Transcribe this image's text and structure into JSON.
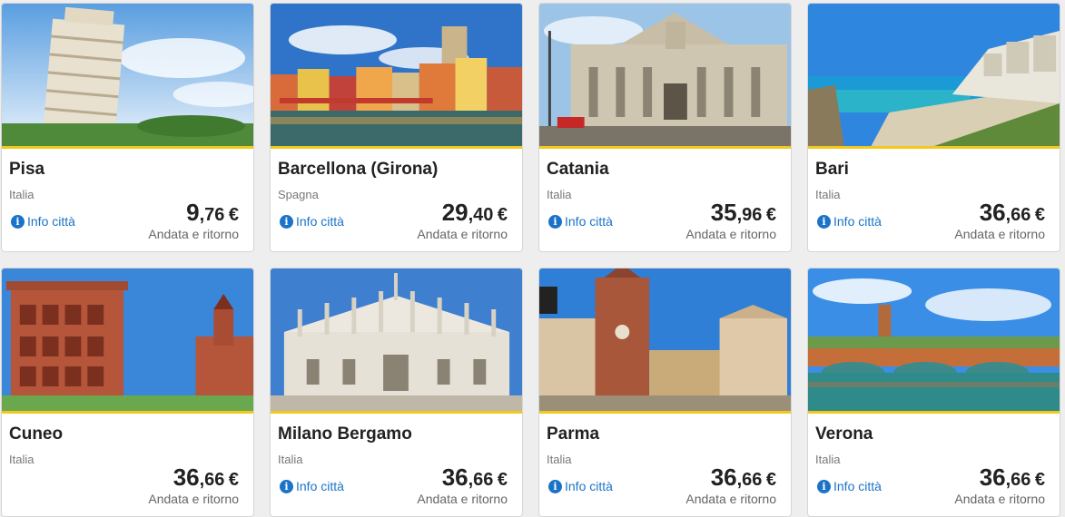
{
  "cards": [
    {
      "city": "Pisa",
      "country": "Italia",
      "info": "Info città",
      "price_int": "9",
      "price_dec": ",76",
      "currency": "€",
      "trip": "Andata e ritorno",
      "show_info": true,
      "scene": "pisa"
    },
    {
      "city": "Barcellona (Girona)",
      "country": "Spagna",
      "info": "Info città",
      "price_int": "29",
      "price_dec": ",40",
      "currency": "€",
      "trip": "Andata e ritorno",
      "show_info": true,
      "scene": "girona"
    },
    {
      "city": "Catania",
      "country": "Italia",
      "info": "Info città",
      "price_int": "35",
      "price_dec": ",96",
      "currency": "€",
      "trip": "Andata e ritorno",
      "show_info": true,
      "scene": "catania"
    },
    {
      "city": "Bari",
      "country": "Italia",
      "info": "Info città",
      "price_int": "36",
      "price_dec": ",66",
      "currency": "€",
      "trip": "Andata e ritorno",
      "show_info": true,
      "scene": "bari"
    },
    {
      "city": "Cuneo",
      "country": "Italia",
      "info": "",
      "price_int": "36",
      "price_dec": ",66",
      "currency": "€",
      "trip": "Andata e ritorno",
      "show_info": false,
      "scene": "cuneo"
    },
    {
      "city": "Milano Bergamo",
      "country": "Italia",
      "info": "Info città",
      "price_int": "36",
      "price_dec": ",66",
      "currency": "€",
      "trip": "Andata e ritorno",
      "show_info": true,
      "scene": "milano"
    },
    {
      "city": "Parma",
      "country": "Italia",
      "info": "Info città",
      "price_int": "36",
      "price_dec": ",66",
      "currency": "€",
      "trip": "Andata e ritorno",
      "show_info": true,
      "scene": "parma"
    },
    {
      "city": "Verona",
      "country": "Italia",
      "info": "Info città",
      "price_int": "36",
      "price_dec": ",66",
      "currency": "€",
      "trip": "Andata e ritorno",
      "show_info": true,
      "scene": "verona"
    }
  ],
  "colors": {
    "accent": "#f2c81b",
    "link": "#1a73c8"
  }
}
